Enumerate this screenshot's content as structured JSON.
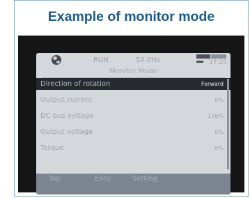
{
  "caption": "Example of monitor mode",
  "screen": {
    "status": {
      "run": "RUN",
      "frequency": "50.0Hz",
      "clock": "17:25"
    },
    "title": "Monitor Mode",
    "rows": [
      {
        "label": "Direction of rotation",
        "value": "Forward",
        "selected": true
      },
      {
        "label": "Output current",
        "value": "0%"
      },
      {
        "label": "DC bus voltage",
        "value": "116%"
      },
      {
        "label": "Output voltage",
        "value": "0%"
      },
      {
        "label": "Torque",
        "value": "0%"
      }
    ],
    "softkeys": [
      "Top",
      "Easy",
      "Setting"
    ]
  },
  "colors": {
    "caption": "#1f5b86",
    "frame_border": "#8fb3cc",
    "bezel": "#151515",
    "lcd": "#d4d7dc",
    "selected_row": "#26292f"
  }
}
